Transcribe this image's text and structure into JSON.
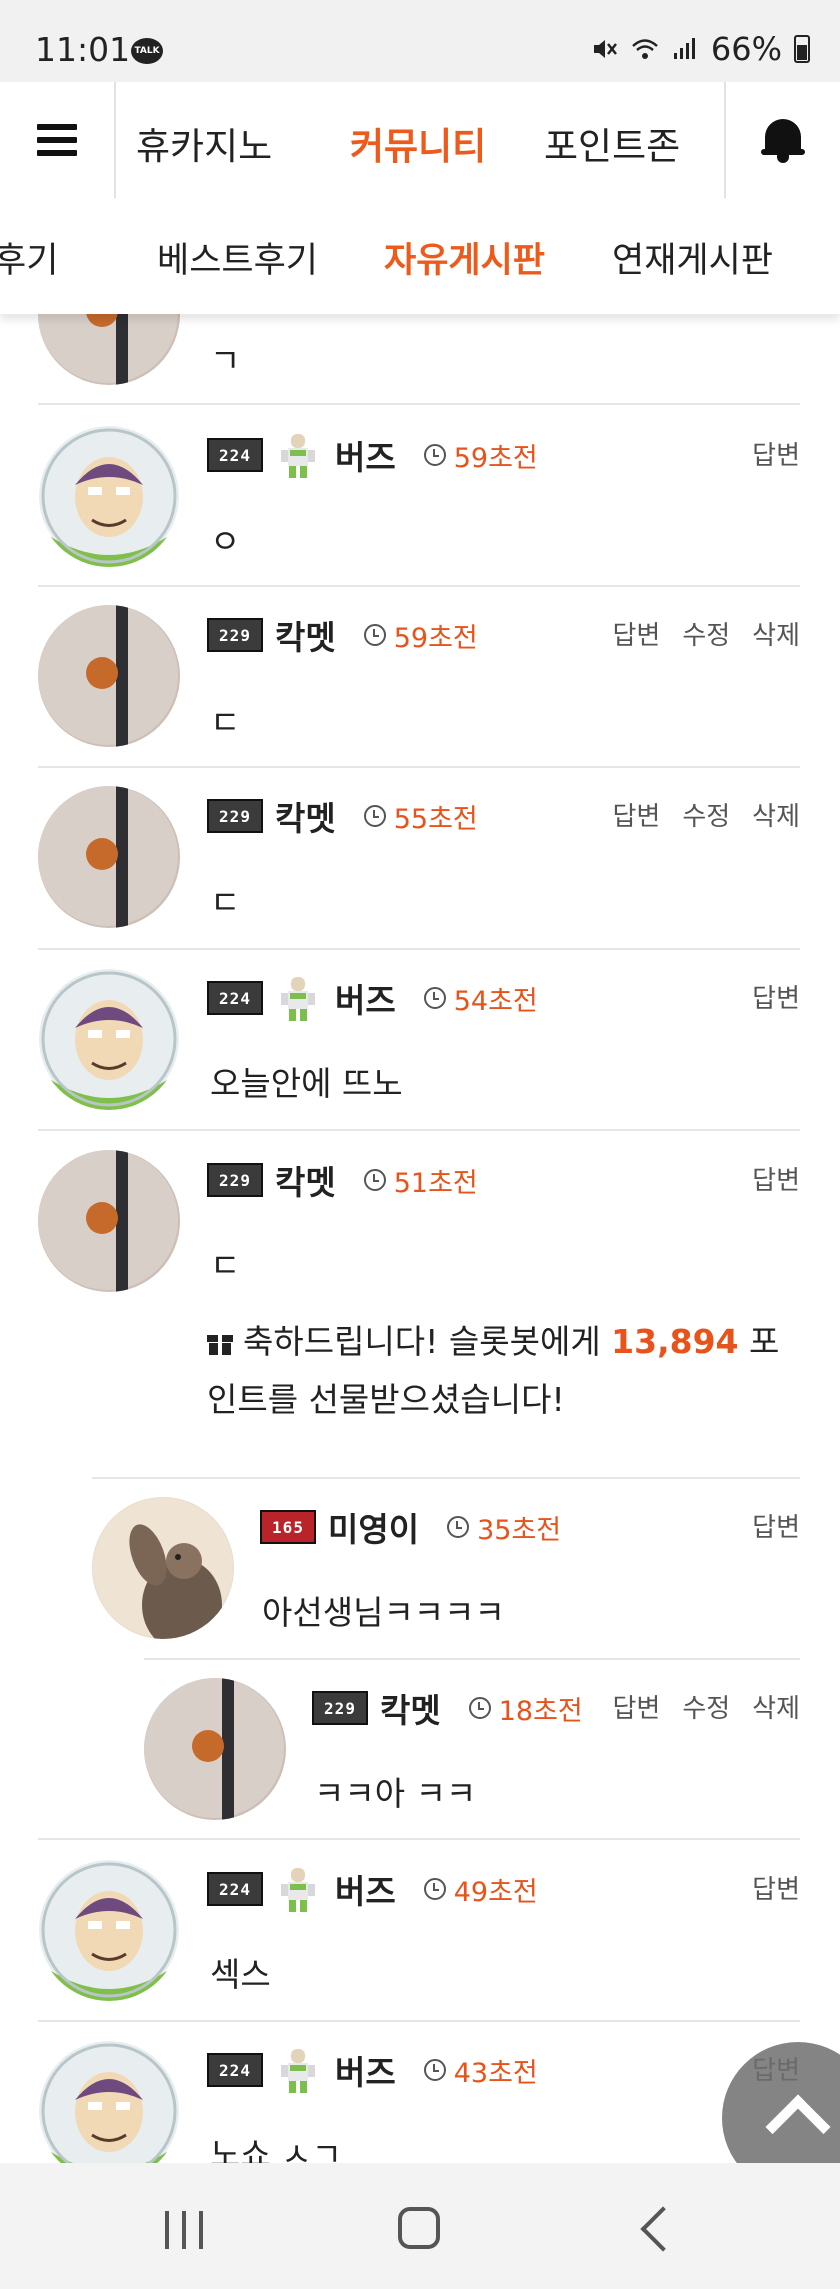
{
  "status_bar": {
    "time": "11:01",
    "talk_badge": "TALK",
    "battery": "66%"
  },
  "top_nav": {
    "tabs": [
      {
        "label": "휴카지노"
      },
      {
        "label": "커뮤니티",
        "active": true
      },
      {
        "label": "포인트존"
      }
    ]
  },
  "sub_nav": {
    "tabs": [
      {
        "label": "후기"
      },
      {
        "label": "베스트후기"
      },
      {
        "label": "자유게시판",
        "active": true
      },
      {
        "label": "연재게시판"
      }
    ]
  },
  "comments": [
    {
      "body": "ㄱ"
    },
    {
      "level": "224",
      "nick": "버즈",
      "time": "59초전",
      "actions": [
        "답변"
      ],
      "body": "ㅇ",
      "avatar": "buzz"
    },
    {
      "level": "229",
      "nick": "칵멧",
      "time": "59초전",
      "actions": [
        "답변",
        "수정",
        "삭제"
      ],
      "body": "ㄷ",
      "avatar": "chopstick"
    },
    {
      "level": "229",
      "nick": "칵멧",
      "time": "55초전",
      "actions": [
        "답변",
        "수정",
        "삭제"
      ],
      "body": "ㄷ",
      "avatar": "chopstick"
    },
    {
      "level": "224",
      "nick": "버즈",
      "time": "54초전",
      "actions": [
        "답변"
      ],
      "body": "오늘안에 뜨노",
      "avatar": "buzz"
    },
    {
      "level": "229",
      "nick": "칵멧",
      "time": "51초전",
      "actions": [
        "답변"
      ],
      "body": "ㄷ",
      "avatar": "chopstick",
      "gift": {
        "prefix": "축하드립니다! 슬롯봇에게 ",
        "points": "13,894",
        "suffix": " 포인트를 선물받으셨습니다!"
      }
    },
    {
      "level": "165",
      "nick": "미영이",
      "time": "35초전",
      "actions": [
        "답변"
      ],
      "body": "아선생님ㅋㅋㅋㅋ",
      "avatar": "otter"
    },
    {
      "level": "229",
      "nick": "칵멧",
      "time": "18초전",
      "actions": [
        "답변",
        "수정",
        "삭제"
      ],
      "body": "ㅋㅋ아 ㅋㅋ",
      "avatar": "chopstick"
    },
    {
      "level": "224",
      "nick": "버즈",
      "time": "49초전",
      "actions": [
        "답변"
      ],
      "body": "섹스",
      "avatar": "buzz"
    },
    {
      "level": "224",
      "nick": "버즈",
      "time": "43초전",
      "actions": [
        "답변"
      ],
      "body": "노쇼 ㅅㄱ",
      "avatar": "buzz"
    }
  ],
  "colors": {
    "accent": "#ee5a1b",
    "time_text": "#e8531b",
    "divider": "#e6e6e6"
  },
  "icons": [
    "hamburger-icon",
    "bell-icon",
    "clock-icon",
    "gift-icon",
    "chevron-up-icon"
  ]
}
